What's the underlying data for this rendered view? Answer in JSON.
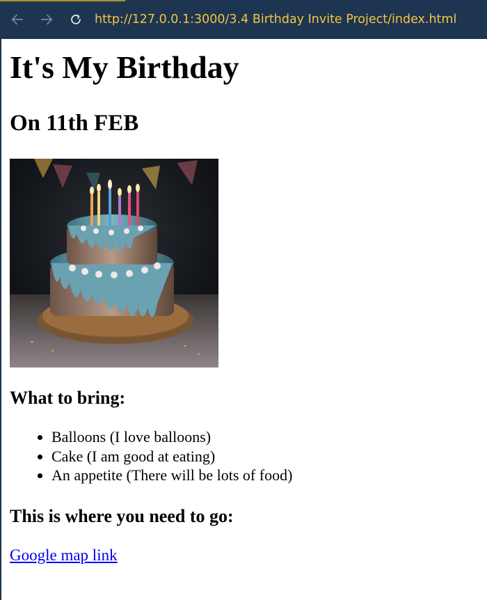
{
  "browser": {
    "url": "http://127.0.0.1:3000/3.4 Birthday Invite Project/index.html",
    "icons": [
      "back-arrow-icon",
      "forward-arrow-icon",
      "refresh-icon"
    ]
  },
  "page": {
    "title": "It's My Birthday",
    "date_heading": "On 11th FEB",
    "bring_heading": "What to bring:",
    "bring_items": [
      "Balloons (I love balloons)",
      "Cake (I am good at eating)",
      "An appetite (There will be lots of food)"
    ],
    "location_heading": "This is where you need to go:",
    "map_link": "Google map link"
  },
  "colors": {
    "toolbar_bg": "#1d3550",
    "url_text": "#f6c343",
    "link": "#0000ee"
  }
}
